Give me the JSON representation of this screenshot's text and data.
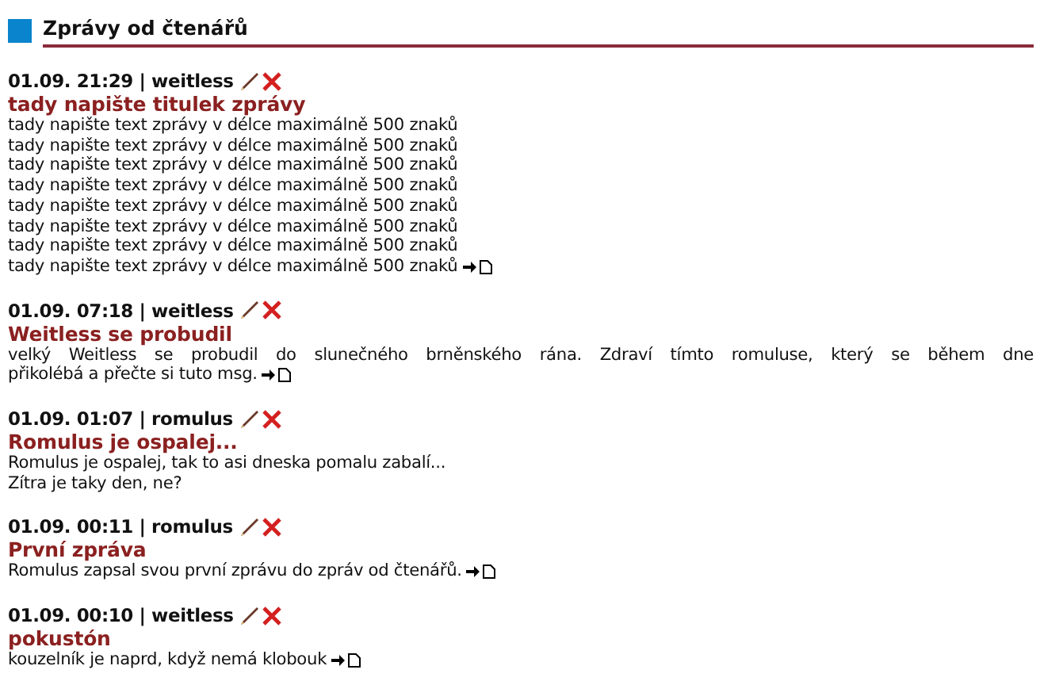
{
  "section": {
    "title": "Zprávy od čtenářů"
  },
  "messages": [
    {
      "meta": "01.09. 21:29 | weitless",
      "title": "tady napište titulek zprávy",
      "lines": [
        {
          "text": "tady napište text zprávy v délce maximálně 500 znaků",
          "wrapped": false
        },
        {
          "text": "tady napište text zprávy v délce maximálně 500 znaků",
          "wrapped": false
        },
        {
          "text": "tady napište text zprávy v délce maximálně 500 znaků",
          "wrapped": false
        },
        {
          "text": "tady napište text zprávy v délce maximálně 500 znaků",
          "wrapped": false
        },
        {
          "text": "tady napište text zprávy v délce maximálně 500 znaků",
          "wrapped": false
        },
        {
          "text": "tady napište text zprávy v délce maximálně 500 znaků",
          "wrapped": false
        },
        {
          "text": "tady napište text zprávy v délce maximálně 500 znaků",
          "wrapped": false
        },
        {
          "text": "tady napište text zprávy v délce maximálně 500 znaků",
          "wrapped": false
        }
      ],
      "more_link": true
    },
    {
      "meta": "01.09. 07:18 | weitless",
      "title": "Weitless se probudil",
      "lines": [
        {
          "text": "velký Weitless se probudil do slunečného brněnského rána. Zdraví tímto romuluse, který se během dne",
          "wrapped": true
        },
        {
          "text": "přikolébá a přečte si tuto msg.",
          "wrapped": false
        }
      ],
      "more_link": true
    },
    {
      "meta": "01.09. 01:07 | romulus",
      "title": "Romulus je ospalej...",
      "lines": [
        {
          "text": "Romulus je ospalej, tak to asi dneska pomalu zabalí...",
          "wrapped": false
        },
        {
          "text": "Zítra je taky den, ne?",
          "wrapped": false
        }
      ],
      "more_link": false
    },
    {
      "meta": "01.09. 00:11 | romulus",
      "title": "První zpráva",
      "lines": [
        {
          "text": "Romulus zapsal svou první zprávu do zpráv od čtenářů.",
          "wrapped": false
        }
      ],
      "more_link": true
    },
    {
      "meta": "01.09. 00:10 | weitless",
      "title": "pokustón",
      "lines": [
        {
          "text": "kouzelník je naprd, když nemá klobouk",
          "wrapped": false
        }
      ],
      "more_link": true
    }
  ]
}
